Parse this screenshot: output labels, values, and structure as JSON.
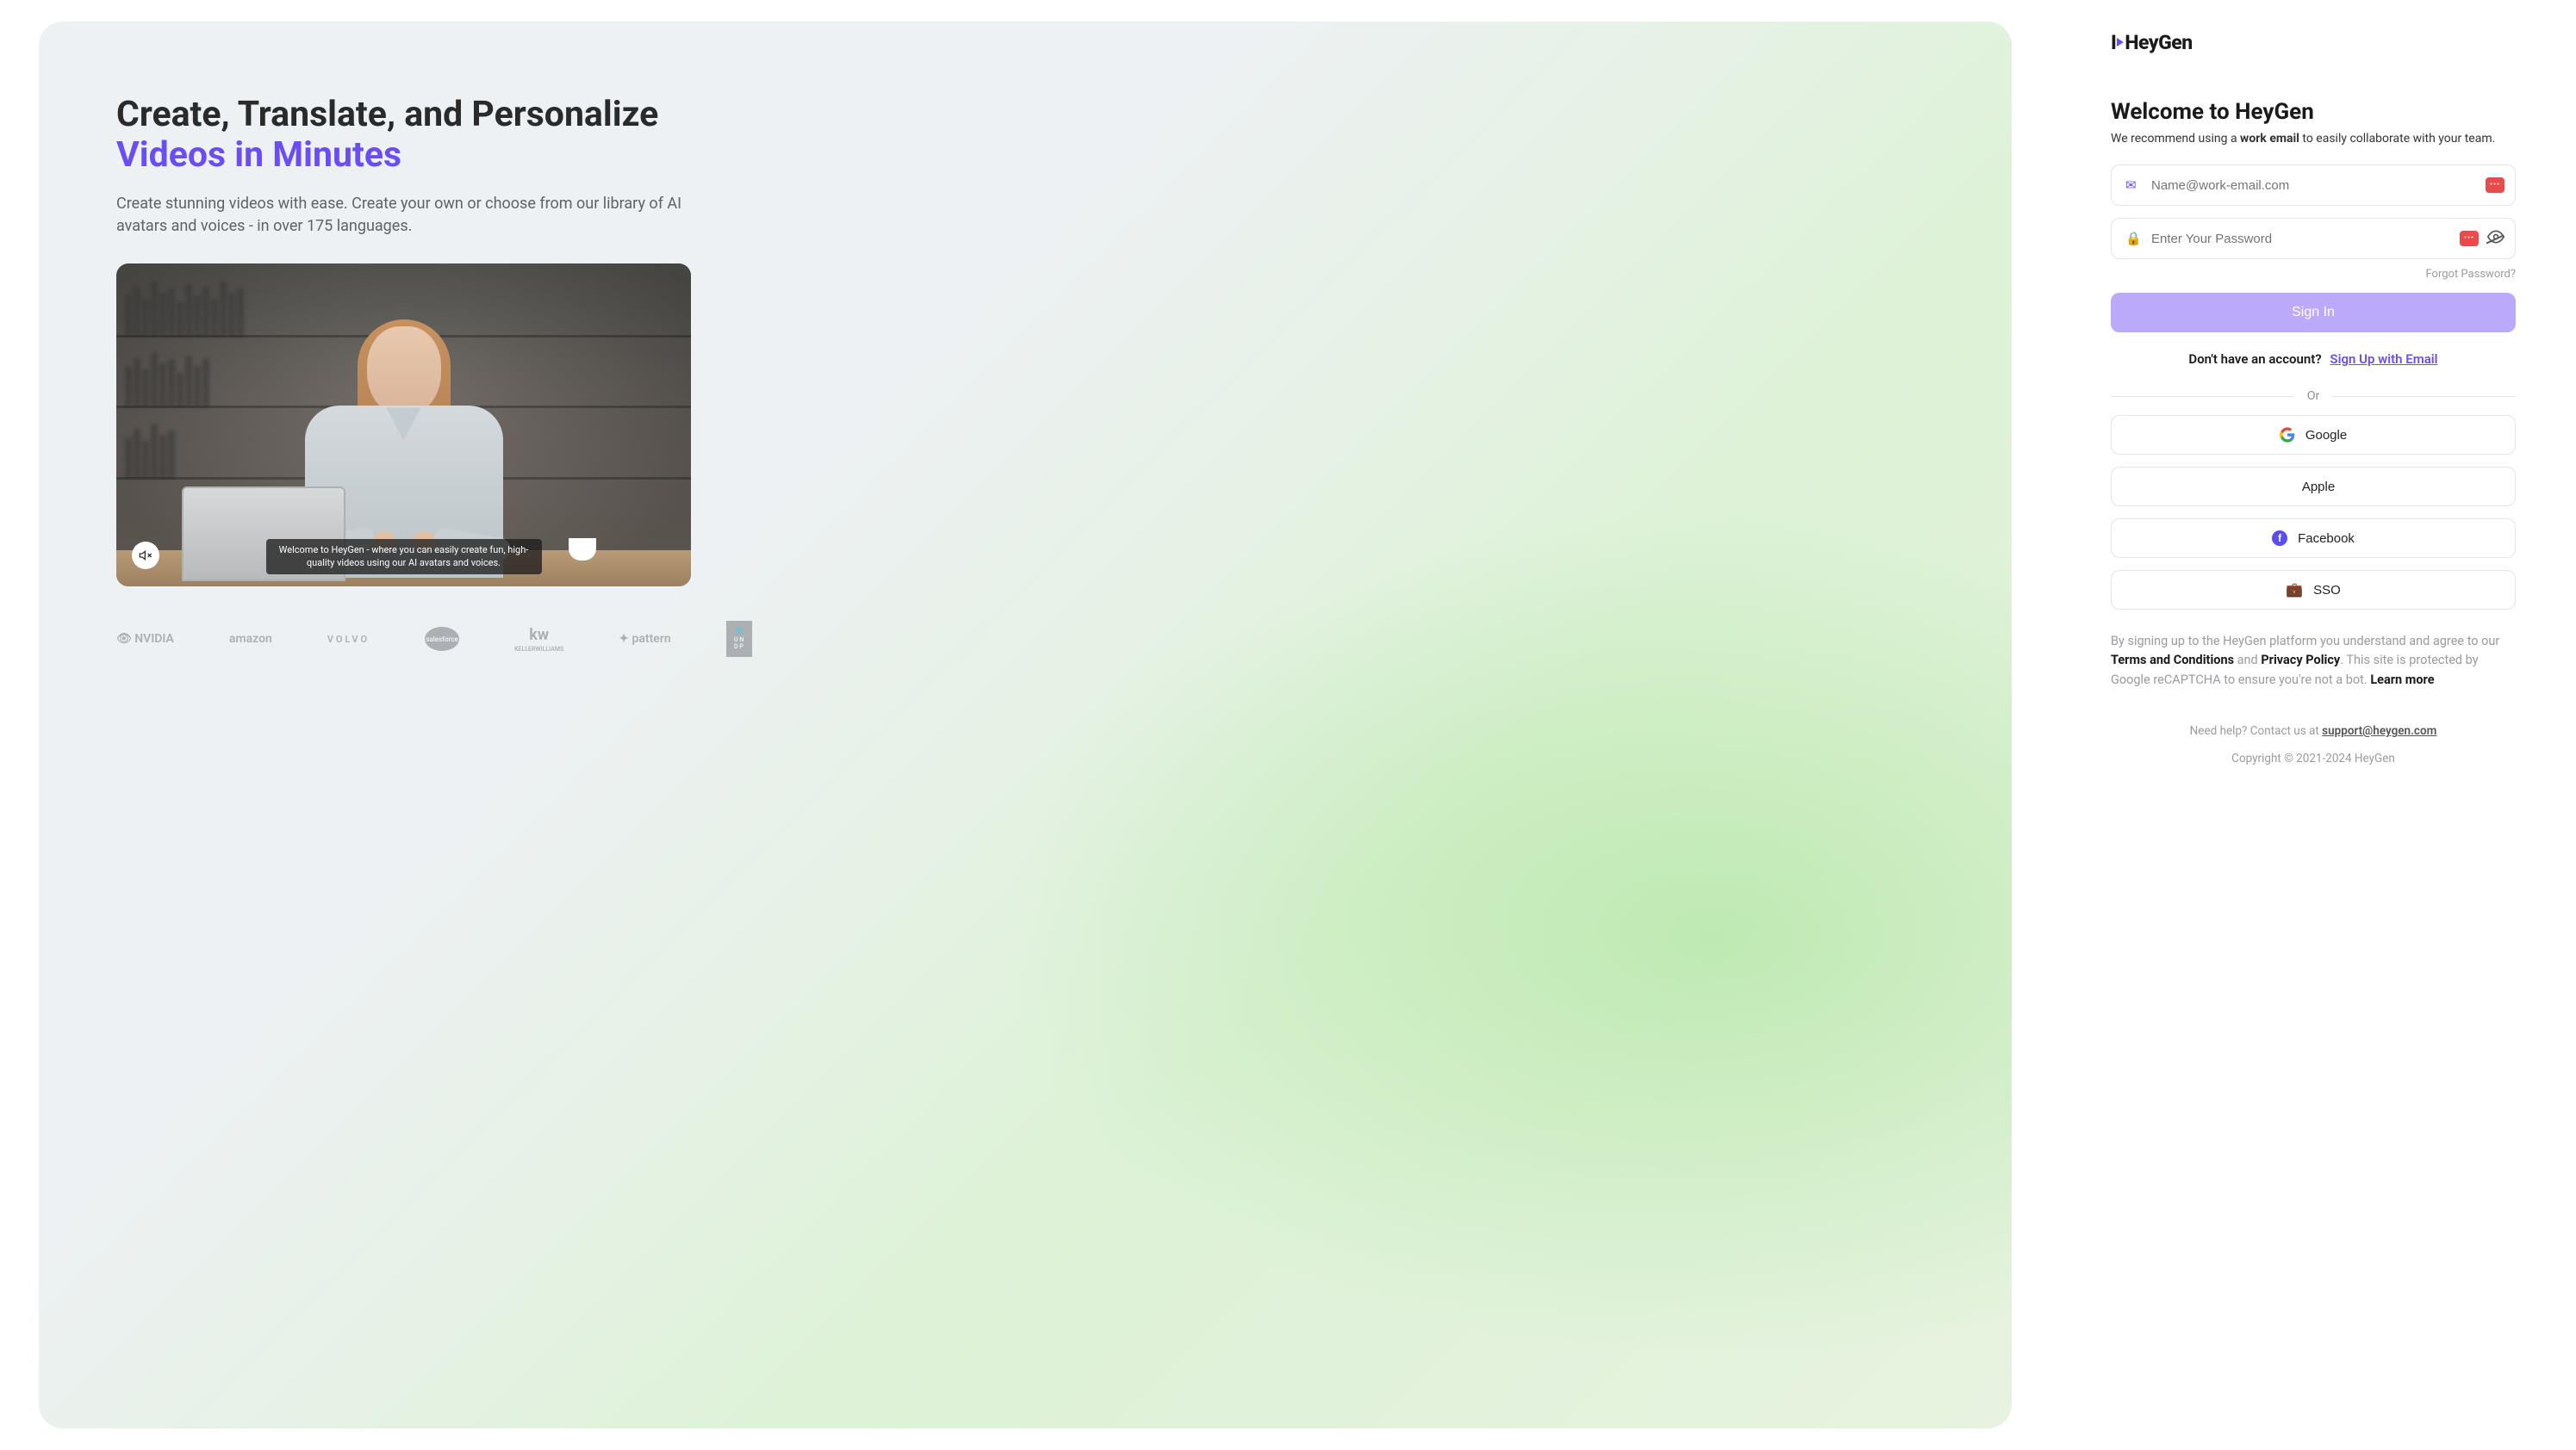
{
  "left": {
    "headline_line1": "Create, Translate, and Personalize",
    "headline_line2": "Videos in Minutes",
    "subhead": "Create stunning videos with ease. Create your own or choose from our library of AI avatars and voices - in over 175 languages.",
    "caption": "Welcome to HeyGen - where you can easily create fun, high-quality videos using our AI avatars and voices.",
    "mute_icon": "volume-mute-icon",
    "logos": [
      "NVIDIA",
      "amazon",
      "VOLVO",
      "salesforce",
      "KW KELLERWILLIAMS",
      "pattern",
      "UNDP"
    ]
  },
  "right": {
    "brand": "HeyGen",
    "welcome": "Welcome to HeyGen",
    "recommend_pre": "We recommend using a ",
    "recommend_bold": "work email",
    "recommend_post": " to easily collaborate with your team.",
    "email_placeholder": "Name@work-email.com",
    "password_placeholder": "Enter Your Password",
    "forgot": "Forgot Password?",
    "signin": "Sign In",
    "no_account": "Don't have an account?",
    "signup_link": "Sign Up with Email",
    "or": "Or",
    "social": {
      "google": "Google",
      "apple": "Apple",
      "facebook": "Facebook",
      "sso": "SSO"
    },
    "legal_pre": "By signing up to the HeyGen platform you understand and agree to our ",
    "terms": "Terms and Conditions",
    "legal_and": " and ",
    "privacy": "Privacy Policy",
    "legal_post": ". This site is protected by Google reCAPTCHA to ensure you're not a bot. ",
    "learn_more": "Learn more",
    "help_pre": "Need help? Contact us at ",
    "help_email": "support@heygen.com",
    "copyright": "Copyright © 2021-2024 HeyGen"
  }
}
